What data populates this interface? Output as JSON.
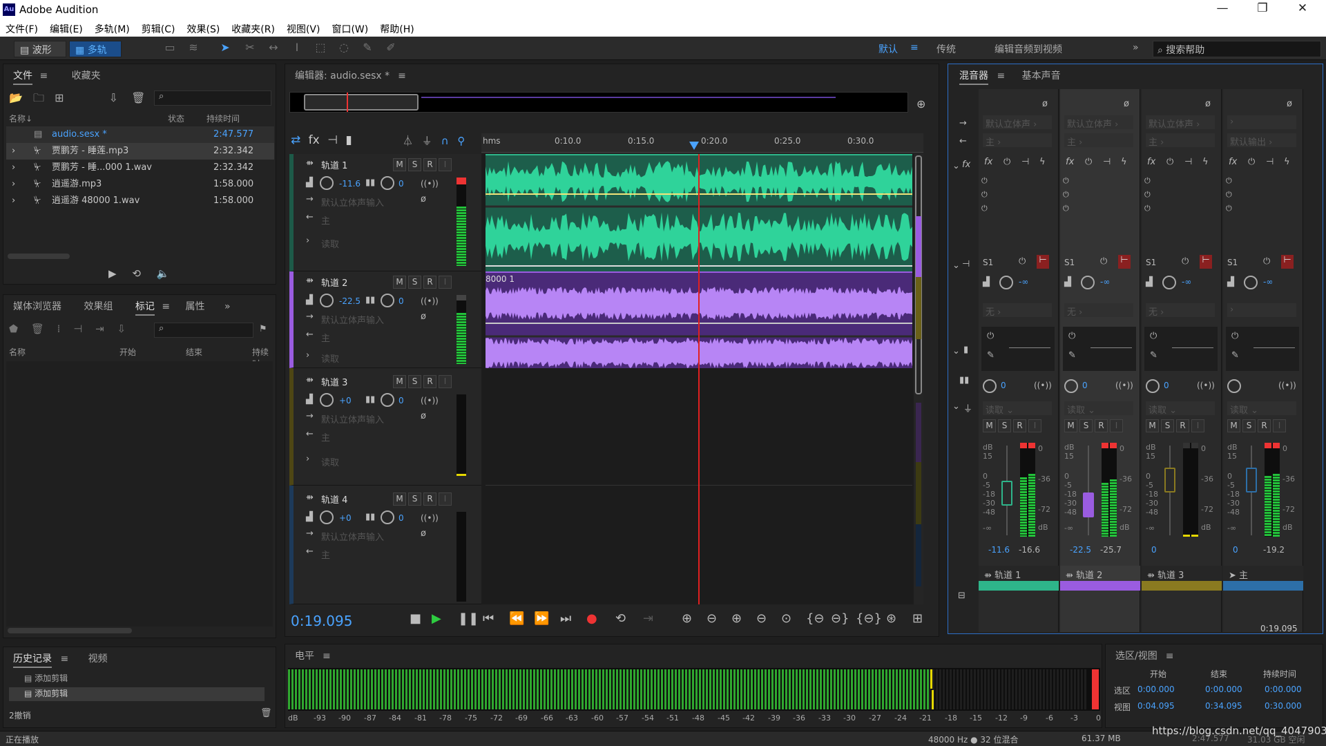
{
  "app": {
    "title": "Adobe Audition",
    "logo": "Au"
  },
  "menu": [
    "文件(F)",
    "编辑(E)",
    "多轨(M)",
    "剪辑(C)",
    "效果(S)",
    "收藏夹(R)",
    "视图(V)",
    "窗口(W)",
    "帮助(H)"
  ],
  "toolbar": {
    "waveform_label": "波形",
    "multitrack_label": "多轨",
    "workspaces": [
      "默认",
      "传统",
      "编辑音频到视频"
    ],
    "search_placeholder": "搜索帮助"
  },
  "files_panel": {
    "tabs": [
      "文件",
      "收藏夹"
    ],
    "columns": [
      "名称",
      "状态",
      "持续时间"
    ],
    "items": [
      {
        "name": "audio.sesx *",
        "duration": "2:47.577",
        "type": "session"
      },
      {
        "name": "贾鹏芳 - 睡莲.mp3",
        "duration": "2:32.342",
        "type": "audio"
      },
      {
        "name": "贾鹏芳 - 睡...000 1.wav",
        "duration": "2:32.342",
        "type": "audio"
      },
      {
        "name": "逍遥游.mp3",
        "duration": "1:58.000",
        "type": "audio"
      },
      {
        "name": "逍遥游 48000 1.wav",
        "duration": "1:58.000",
        "type": "audio"
      }
    ]
  },
  "markers_panel": {
    "tabs": [
      "媒体浏览器",
      "效果组",
      "标记",
      "属性"
    ],
    "columns": [
      "名称",
      "开始",
      "结束",
      "持续时"
    ]
  },
  "history_panel": {
    "tabs": [
      "历史记录",
      "视频"
    ],
    "items": [
      "添加剪辑",
      "添加剪辑"
    ],
    "undo_count": "2撤销"
  },
  "status": {
    "left": "正在播放",
    "right": "48000 Hz ● 32 位混合",
    "mem": "61.37 MB",
    "dur": "2:47.577",
    "disk": "31.03 GB 空闲"
  },
  "watermark": "https://blog.csdn.net/qq_40479037",
  "editor": {
    "title": "编辑器: audio.sesx *",
    "ruler": [
      "hms",
      "0:10.0",
      "0:15.0",
      "0:20.0",
      "0:25.0",
      "0:30.0"
    ],
    "playhead_fraction": 0.498,
    "current_time": "0:19.095",
    "clip2_label": "8000 1",
    "tracks": [
      {
        "name": "轨道 1",
        "vol": "-11.6",
        "pan": "0",
        "input": "默认立体声输入",
        "output": "主",
        "mode": "读取",
        "color": "#2eb58a"
      },
      {
        "name": "轨道 2",
        "vol": "-22.5",
        "pan": "0",
        "input": "默认立体声输入",
        "output": "主",
        "mode": "读取",
        "color": "#9a5ce0"
      },
      {
        "name": "轨道 3",
        "vol": "+0",
        "pan": "0",
        "input": "默认立体声输入",
        "output": "主",
        "mode": "读取",
        "color": "#8a7a20"
      },
      {
        "name": "轨道 4",
        "vol": "+0",
        "pan": "0",
        "input": "默认立体声输入",
        "output": "主",
        "mode": "读取",
        "color": "#2d6fa8"
      }
    ],
    "btn_m": "M",
    "btn_s": "S",
    "btn_r": "R",
    "btn_i": "I"
  },
  "mixer": {
    "tabs": [
      "混音器",
      "基本声音"
    ],
    "strips": [
      {
        "name": "轨道 1",
        "input": "默认立体声",
        "output": "主",
        "send": "S1",
        "send_none": "无",
        "mode": "读取",
        "vol": "-11.6",
        "peak": "-16.6",
        "pan": "0",
        "color": "#2eb58a",
        "level_l": 0.68,
        "level_r": 0.72
      },
      {
        "name": "轨道 2",
        "input": "默认立体声",
        "output": "主",
        "send": "S1",
        "send_none": "无",
        "mode": "读取",
        "vol": "-22.5",
        "peak": "-25.7",
        "pan": "0",
        "color": "#9a5ce0",
        "level_l": 0.62,
        "level_r": 0.66
      },
      {
        "name": "轨道 3",
        "input": "默认立体声",
        "output": "主",
        "send": "S1",
        "send_none": "无",
        "mode": "读取",
        "vol": "0",
        "peak": "",
        "pan": "0",
        "color": "#8a7a20",
        "level_l": 0.0,
        "level_r": 0.0
      },
      {
        "name": "主",
        "input": "",
        "output": "默认输出",
        "send": "S1",
        "send_none": "",
        "mode": "读取",
        "vol": "0",
        "peak": "-19.2",
        "pan": "",
        "color": "#2d6fa8",
        "level_l": 0.7,
        "level_r": 0.72
      }
    ],
    "db_scale": [
      "dB",
      "15",
      "0",
      "-5",
      "-18",
      "-30",
      "-48",
      "-∞"
    ],
    "meter_scale": [
      "0",
      "-36",
      "-72",
      "dB"
    ],
    "time": "0:19.095"
  },
  "levels_panel": {
    "title": "电平",
    "scale": [
      "dB",
      "-93",
      "-90",
      "-87",
      "-84",
      "-81",
      "-78",
      "-75",
      "-72",
      "-69",
      "-66",
      "-63",
      "-60",
      "-57",
      "-54",
      "-51",
      "-48",
      "-45",
      "-42",
      "-39",
      "-36",
      "-33",
      "-30",
      "-27",
      "-24",
      "-21",
      "-18",
      "-15",
      "-12",
      "-9",
      "-6",
      "-3",
      "0"
    ],
    "level_fraction": 0.73
  },
  "selection_panel": {
    "title": "选区/视图",
    "columns": [
      "开始",
      "结束",
      "持续时间"
    ],
    "rows": [
      {
        "label": "选区",
        "start": "0:00.000",
        "end": "0:00.000",
        "dur": "0:00.000"
      },
      {
        "label": "视图",
        "start": "0:04.095",
        "end": "0:34.095",
        "dur": "0:30.000"
      }
    ]
  }
}
